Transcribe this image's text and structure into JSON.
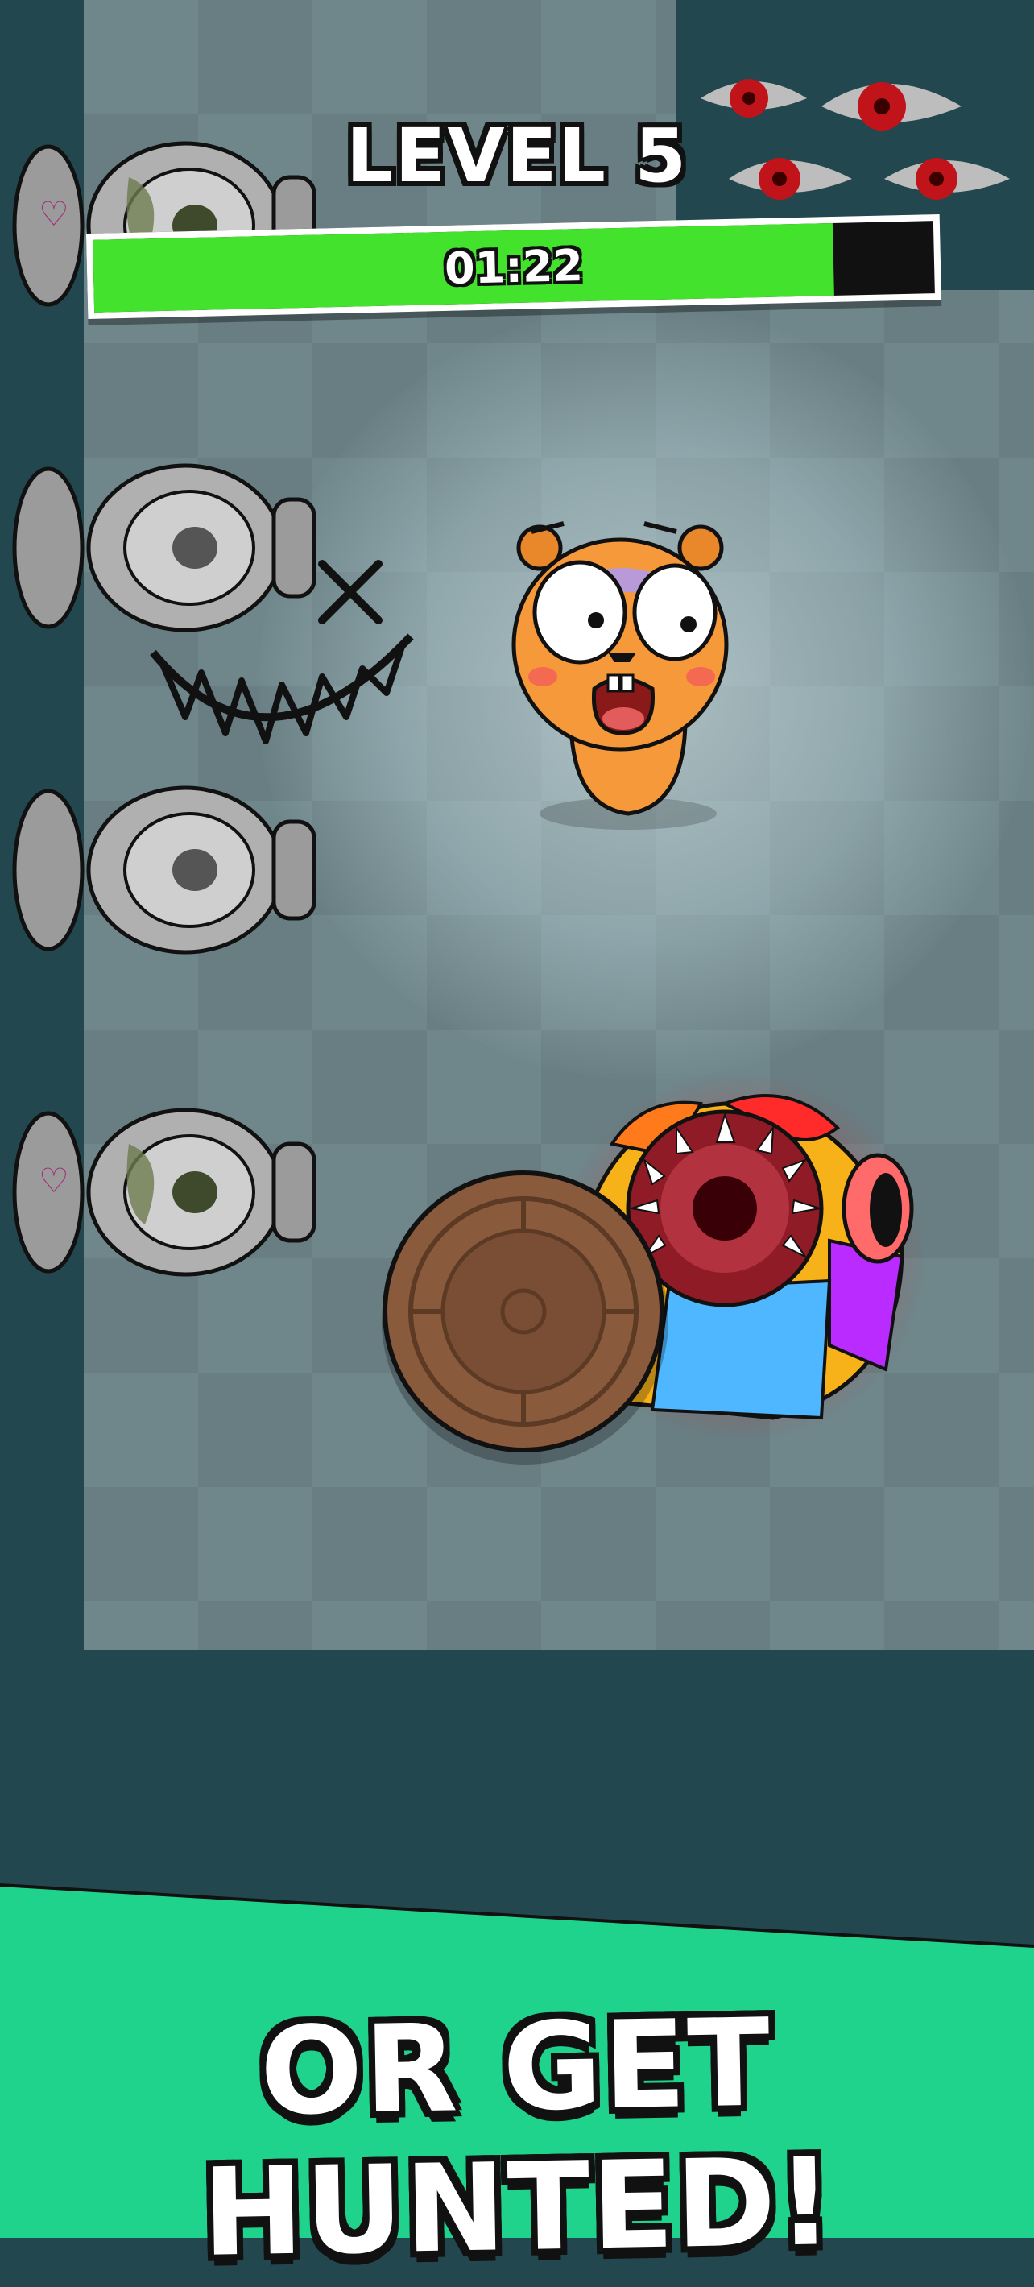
{
  "level": {
    "title": "LEVEL 5"
  },
  "timer": {
    "text": "01:22",
    "remaining_fraction": 0.88
  },
  "caption": {
    "text": "OR GET HUNTED!"
  },
  "scene": {
    "toilet_count": 4,
    "eye_count": 4,
    "player_character": "scared-hamster",
    "enemy": "rainbow-monster",
    "obstacle": "wooden-manhole-cover"
  },
  "colors": {
    "background": "#23474f",
    "floor": "#6f868b",
    "timer_fill": "#43e22c",
    "caption_band": "#20d38d",
    "eye_red": "#c0141a"
  }
}
